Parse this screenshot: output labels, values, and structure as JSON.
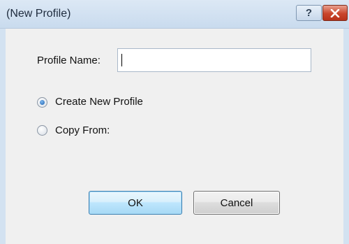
{
  "window": {
    "title": "(New Profile)",
    "help_label": "?"
  },
  "form": {
    "profile_name_label": "Profile Name:",
    "profile_name_value": "",
    "options": [
      {
        "label": "Create New Profile",
        "checked": true
      },
      {
        "label": "Copy From:",
        "checked": false
      }
    ]
  },
  "buttons": {
    "ok_label": "OK",
    "cancel_label": "Cancel"
  },
  "icons": {
    "help": "help-icon",
    "close": "close-icon"
  },
  "colors": {
    "titlebar": "#c9dbee",
    "close_button": "#c9452b",
    "dialog_face": "#f0f0f0",
    "radio_selected": "#1b5fad"
  }
}
